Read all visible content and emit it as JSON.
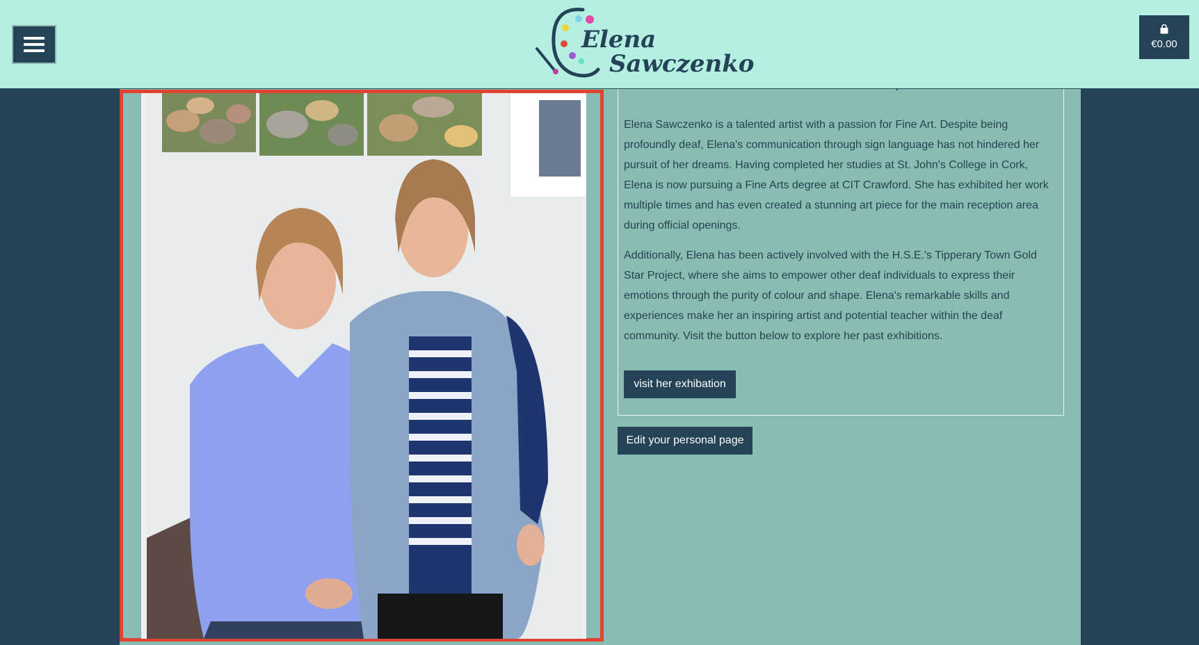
{
  "header": {
    "menu_icon": "hamburger-menu-icon",
    "logo": {
      "first_name": "Elena",
      "last_name": "Sawczenko",
      "icon": "palette-brush-icon"
    },
    "cart": {
      "icon": "shopping-bag-icon",
      "total": "€0.00"
    }
  },
  "profile": {
    "photo_alt": "Photo of two women standing in front of painted canvases",
    "bio_paragraphs": [
      "Elena Sawczenko is a talented artist with a passion for Fine Art. Despite being profoundly deaf, Elena's communication through sign language has not hindered her pursuit of her dreams. Having completed her studies at St. John's College in Cork, Elena is now pursuing a Fine Arts degree at CIT Crawford. She has exhibited her work multiple times and has even created a stunning art piece for the main reception area during official openings.",
      "Additionally, Elena has been actively involved with the H.S.E.'s Tipperary Town Gold Star Project, where she aims to empower other deaf individuals to express their emotions through the purity of colour and shape. Elena's remarkable skills and experiences make her an inspiring artist and potential teacher within the deaf community. Visit the button below to explore her past exhibitions."
    ],
    "exhibition_button": "visit her exhibation",
    "edit_button": "Edit your personal page"
  },
  "colors": {
    "header_bg": "#b5efe2",
    "navy": "#244356",
    "panel_bg": "#89bdb3",
    "highlight": "#e0432f"
  }
}
